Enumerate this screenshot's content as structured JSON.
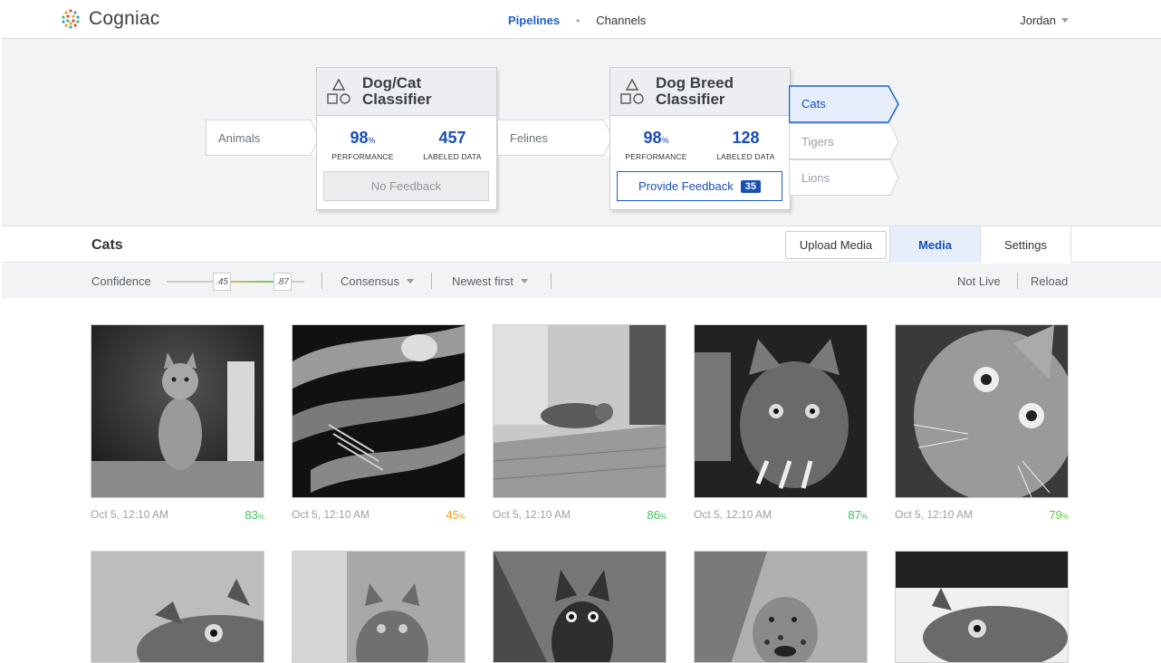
{
  "app": {
    "name": "Cogniac",
    "nav": {
      "pipelines": "Pipelines",
      "channels": "Channels"
    },
    "user": "Jordan"
  },
  "pipeline": {
    "input_label": "Animals",
    "mid_label": "Felines",
    "classifiers": [
      {
        "title_line1": "Dog/Cat",
        "title_line2": "Classifier",
        "performance": "98",
        "labeled_data": "457",
        "performance_caption": "PERFORMANCE",
        "labeled_caption": "LABELED DATA",
        "button_label": "No Feedback",
        "button_state": "disabled"
      },
      {
        "title_line1": "Dog Breed",
        "title_line2": "Classifier",
        "performance": "98",
        "labeled_data": "128",
        "performance_caption": "PERFORMANCE",
        "labeled_caption": "LABELED DATA",
        "button_label": "Provide Feedback",
        "button_badge": "35",
        "button_state": "primary"
      }
    ],
    "outputs": [
      "Cats",
      "Tigers",
      "Lions"
    ],
    "selected_output": "Cats",
    "percent_symbol": "%"
  },
  "section": {
    "title": "Cats",
    "upload_label": "Upload Media",
    "tabs": [
      "Media",
      "Settings"
    ],
    "active_tab": "Media"
  },
  "filters": {
    "confidence_label": "Confidence",
    "confidence_low": ".45",
    "confidence_high": ".87",
    "consensus_label": "Consensus",
    "sort_label": "Newest first",
    "status_label": "Not Live",
    "reload_label": "Reload"
  },
  "media": [
    {
      "date": "Oct 5, 12:10 AM",
      "score": "83",
      "color": "#3cc45a"
    },
    {
      "date": "Oct 5, 12:10 AM",
      "score": "45",
      "color": "#f0a020"
    },
    {
      "date": "Oct 5, 12:10 AM",
      "score": "86",
      "color": "#3cc45a"
    },
    {
      "date": "Oct 5, 12:10 AM",
      "score": "87",
      "color": "#3cc45a"
    },
    {
      "date": "Oct 5, 12:10 AM",
      "score": "79",
      "color": "#5cc83a"
    }
  ],
  "colors": {
    "accent": "#1a5fcf",
    "panel": "#f2f3f5",
    "selected": "#e6eefb"
  }
}
